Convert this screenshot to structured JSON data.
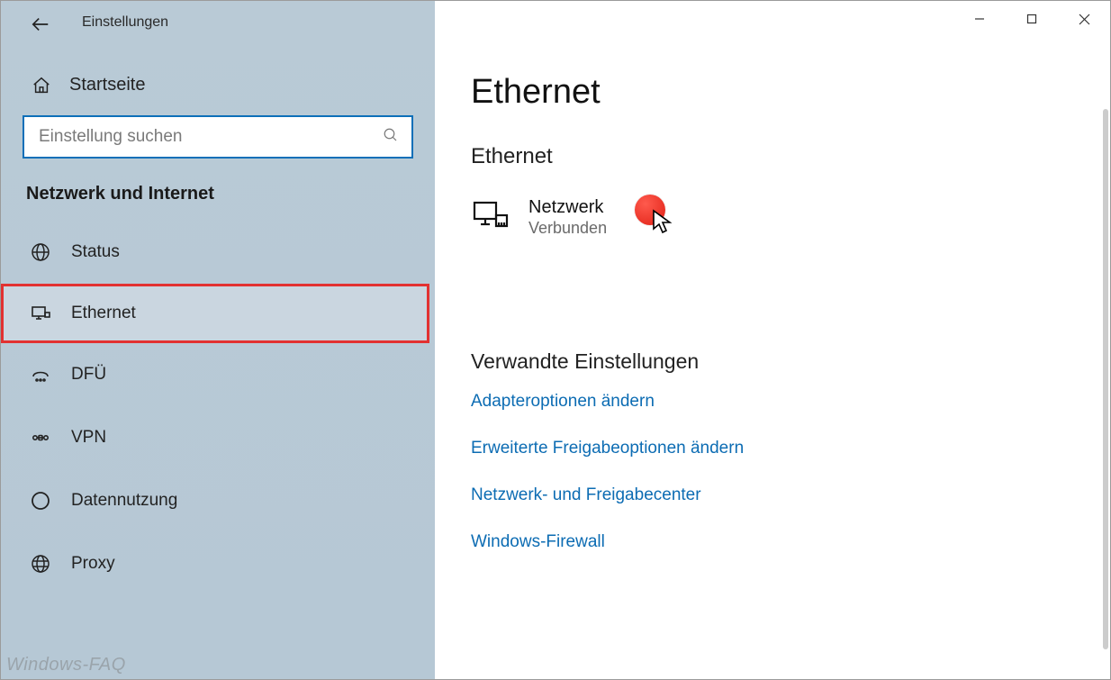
{
  "window": {
    "title": "Einstellungen"
  },
  "sidebar": {
    "home": "Startseite",
    "search_placeholder": "Einstellung suchen",
    "section": "Netzwerk und Internet",
    "items": [
      {
        "label": "Status",
        "icon": "globe-icon",
        "selected": false
      },
      {
        "label": "Ethernet",
        "icon": "ethernet-icon",
        "selected": true
      },
      {
        "label": "DFÜ",
        "icon": "dialup-icon",
        "selected": false
      },
      {
        "label": "VPN",
        "icon": "vpn-icon",
        "selected": false
      },
      {
        "label": "Datennutzung",
        "icon": "datausage-icon",
        "selected": false
      },
      {
        "label": "Proxy",
        "icon": "proxy-icon",
        "selected": false
      }
    ]
  },
  "main": {
    "title": "Ethernet",
    "subtitle": "Ethernet",
    "network": {
      "name": "Netzwerk",
      "status": "Verbunden"
    },
    "related_title": "Verwandte Einstellungen",
    "related_links": [
      "Adapteroptionen ändern",
      "Erweiterte Freigabeoptionen ändern",
      "Netzwerk- und Freigabecenter",
      "Windows-Firewall"
    ]
  },
  "watermark": "Windows-FAQ"
}
